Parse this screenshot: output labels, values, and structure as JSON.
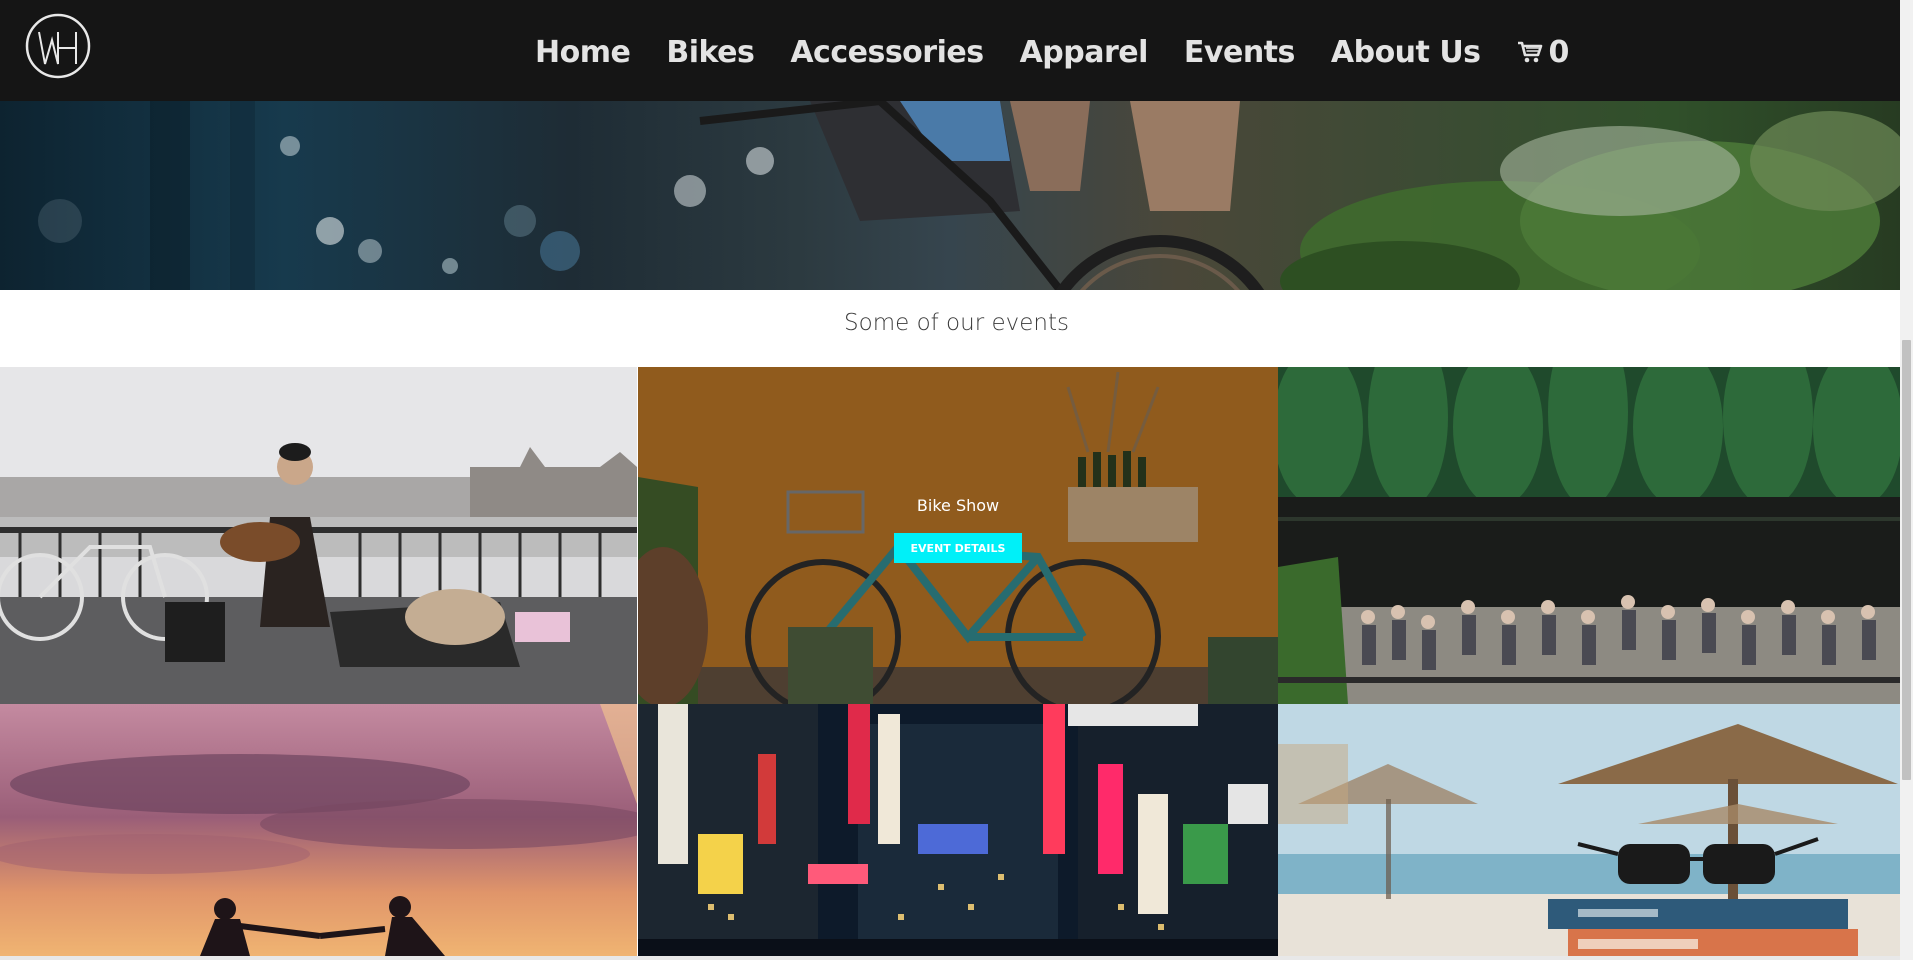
{
  "nav": {
    "links": [
      "Home",
      "Bikes",
      "Accessories",
      "Apparel",
      "Events",
      "About Us"
    ],
    "cart_count": "0",
    "logo_icon": "wh-logo-icon",
    "cart_icon": "cart-icon"
  },
  "section": {
    "title": "Some of our events"
  },
  "events": {
    "hovered_title": "Bike Show",
    "hovered_button": "EVENT DETAILS"
  },
  "colors": {
    "nav_bg": "#151515",
    "nav_text": "#e3e3e3",
    "button_accent": "#00f0f8"
  }
}
